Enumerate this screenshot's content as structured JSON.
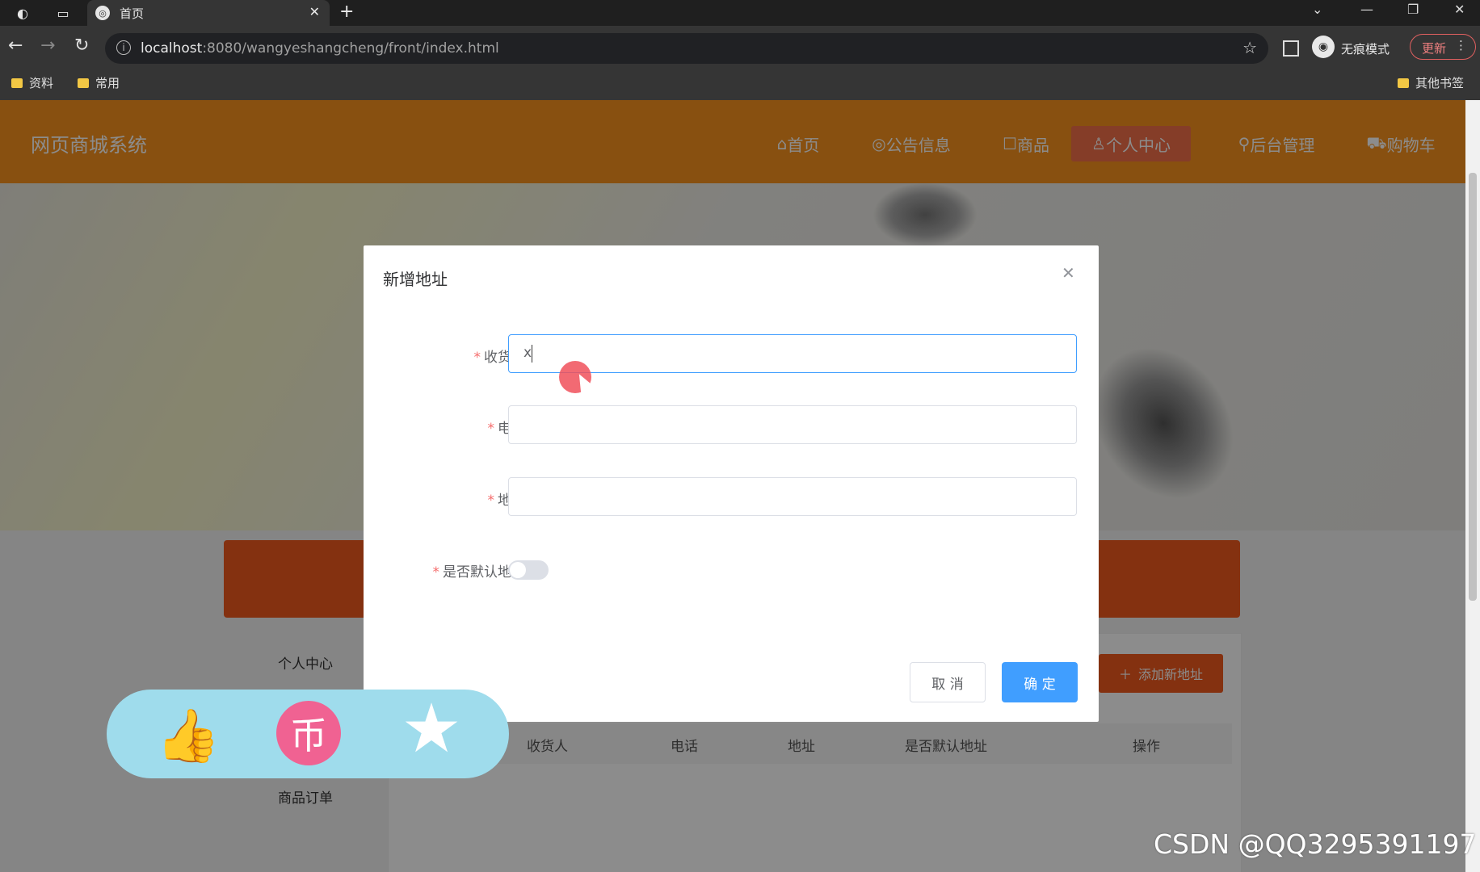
{
  "browser": {
    "tab_title": "首页",
    "tab_favicon": "globe-icon",
    "url_host": "localhost",
    "url_rest": ":8080/wangyeshangcheng/front/index.html",
    "incognito_label": "无痕模式",
    "update_label": "更新",
    "bookmarks": [
      "资料",
      "常用"
    ],
    "other_bookmarks": "其他书签"
  },
  "site": {
    "logo": "网页商城系统",
    "nav": [
      {
        "icon": "⌂",
        "label": "首页"
      },
      {
        "icon": "◎",
        "label": "公告信息"
      },
      {
        "icon": "☐",
        "label": "商品"
      },
      {
        "icon": "♙",
        "label": "个人中心"
      },
      {
        "icon": "⚲",
        "label": "后台管理"
      },
      {
        "icon": "⛟",
        "label": "购物车"
      }
    ],
    "active_nav": "个人中心",
    "sidebar": [
      "个人中心",
      "商品订单"
    ],
    "add_address_button": "添加新地址",
    "table_headers": [
      "收货人",
      "电话",
      "地址",
      "是否默认地址",
      "操作"
    ]
  },
  "dialog": {
    "title": "新增地址",
    "fields": [
      {
        "label": "收货人",
        "value": "x",
        "required": true
      },
      {
        "label": "电话",
        "value": "",
        "required": true
      },
      {
        "label": "地址",
        "value": "",
        "required": true
      }
    ],
    "default_label": "是否默认地址",
    "default_on": false,
    "cancel": "取 消",
    "confirm": "确 定"
  },
  "colors": {
    "header": "#f7931e",
    "accent": "#f05a1e",
    "primary": "#409eff"
  },
  "watermark": "CSDN @QQ3295391197"
}
